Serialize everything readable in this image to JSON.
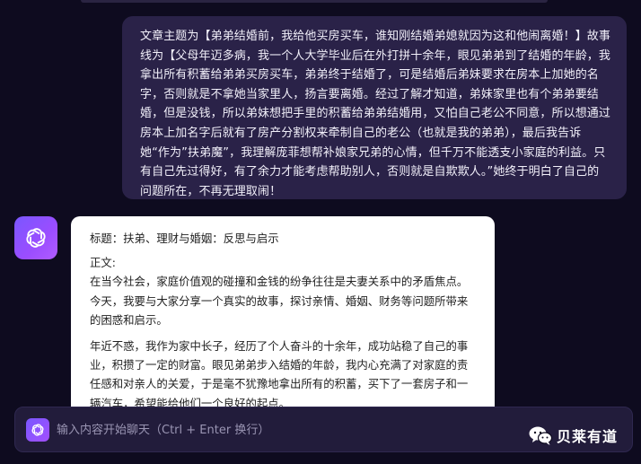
{
  "user_message": {
    "text": "文章主题为【弟弟结婚前，我给他买房买车，谁知刚结婚弟媳就因为这和他闹离婚！】故事线为【父母年迈多病，我一个人大学毕业后在外打拼十余年，眼见弟弟到了结婚的年龄，我拿出所有积蓄给弟弟买房买车，弟弟终于结婚了，可是结婚后弟妹要求在房本上加她的名字，否则就是不拿她当家里人，扬言要离婚。经过了解才知道，弟妹家里也有个弟弟要结婚，但是没钱，所以弟妹想把手里的积蓄给弟弟结婚用，又怕自己老公不同意，所以想通过房本上加名字后就有了房产分割权来牵制自己的老公（也就是我的弟弟），最后我告诉她“作为”扶弟魔”，我理解庞菲想帮补娘家兄弟的心情，但千万不能透支小家庭的利益。只有自己先过得好，有了余力才能考虑帮助别人，否则就是自欺欺人。”她终于明白了自己的问题所在，不再无理取闹！"
  },
  "bot_message": {
    "title": "标题：扶弟、理财与婚姻：反思与启示",
    "body_label": "正文:",
    "paragraph_1": "在当今社会，家庭价值观的碰撞和金钱的纷争往往是夫妻关系中的矛盾焦点。今天，我要与大家分享一个真实的故事，探讨亲情、婚姻、财务等问题所带来的困惑和启示。",
    "paragraph_2": "年近不惑，我作为家中长子，经历了个人奋斗的十余年，成功站稳了自己的事业，积攒了一定的财富。眼见弟弟步入结婚的年龄，我内心充满了对家庭的责任感和对亲人的关爱，于是毫不犹豫地拿出所有的积蓄，买下了一套房子和一辆汽车，希望能给他们一个良好的起点。"
  },
  "input": {
    "placeholder": "输入内容开始聊天（Ctrl + Enter 换行）",
    "value": ""
  },
  "watermark": {
    "text": "贝莱有道"
  },
  "icons": {
    "assistant_avatar": "openai-logo-icon",
    "input_logo": "openai-logo-icon",
    "watermark_logo": "wechat-icon"
  },
  "colors": {
    "background": "#0e0b1f",
    "user_bubble": "#2a2248",
    "bot_bubble": "#ffffff",
    "accent": "#8a55ff"
  }
}
